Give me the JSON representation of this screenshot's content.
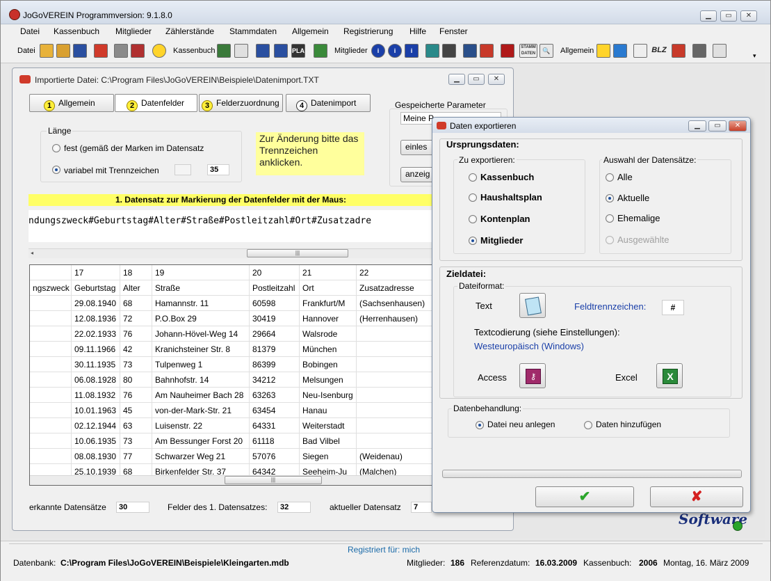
{
  "window": {
    "title": "JoGoVEREIN Programmversion: 9.1.8.0"
  },
  "menu": [
    "Datei",
    "Kassenbuch",
    "Mitglieder",
    "Zählerstände",
    "Stammdaten",
    "Allgemein",
    "Registrierung",
    "Hilfe",
    "Fenster"
  ],
  "toolbar": {
    "labels": {
      "datei": "Datei",
      "kassenbuch": "Kassenbuch",
      "mitglieder": "Mitglieder",
      "allgemein": "Allgemein"
    },
    "icon_texts": {
      "blz": "BLZ",
      "stamm": "STAMM DATEN",
      "plan": "PLAN"
    }
  },
  "import_window": {
    "title": "Importierte Datei: C:\\Program Files\\JoGoVEREIN\\Beispiele\\Datenimport.TXT",
    "tabs": [
      "Allgemein",
      "Datenfelder",
      "Felderzuordnung",
      "Datenimport"
    ],
    "tab_numbers": [
      "1",
      "2",
      "3",
      "4"
    ],
    "laenge": {
      "title": "Länge",
      "opt_fest": "fest (gemäß der Marken im Datensatz",
      "opt_variabel": "variabel mit Trennzeichen",
      "trenn_value": "",
      "field_count": "35"
    },
    "hint": "Zur Änderung bitte das Trennzeichen anklicken.",
    "params": {
      "title": "Gespeicherte Parameter",
      "value": "Meine P",
      "btn_einlesen": "einles",
      "btn_anzeigen": "anzeig"
    },
    "banner": "1. Datensatz zur Markierung der Datenfelder mit der Maus:",
    "record_line": "ndungszweck#Geburtstag#Alter#Straße#Postleitzahl#Ort#Zusatzadre",
    "grid": {
      "col_numbers": [
        "",
        "17",
        "18",
        "19",
        "20",
        "21",
        "22"
      ],
      "col_names": [
        "ngszweck",
        "Geburtstag",
        "Alter",
        "Straße",
        "Postleitzahl",
        "Ort",
        "Zusatzadresse"
      ],
      "rows": [
        [
          "",
          "29.08.1940",
          "68",
          "Hamannstr. 11",
          "60598",
          "Frankfurt/M",
          "(Sachsenhausen)"
        ],
        [
          "",
          "12.08.1936",
          "72",
          "P.O.Box 29",
          "30419",
          "Hannover",
          "(Herrenhausen)"
        ],
        [
          "",
          "22.02.1933",
          "76",
          "Johann-Hövel-Weg 14",
          "29664",
          "Walsrode",
          ""
        ],
        [
          "",
          "09.11.1966",
          "42",
          "Kranichsteiner Str. 8",
          "81379",
          "München",
          ""
        ],
        [
          "",
          "30.11.1935",
          "73",
          "Tulpenweg 1",
          "86399",
          "Bobingen",
          ""
        ],
        [
          "",
          "06.08.1928",
          "80",
          "Bahnhofstr. 14",
          "34212",
          "Melsungen",
          ""
        ],
        [
          "",
          "11.08.1932",
          "76",
          "Am Nauheimer Bach 28",
          "63263",
          "Neu-Isenburg",
          ""
        ],
        [
          "",
          "10.01.1963",
          "45",
          "von-der-Mark-Str. 21",
          "63454",
          "Hanau",
          ""
        ],
        [
          "",
          "02.12.1944",
          "63",
          "Luisenstr. 22",
          "64331",
          "Weiterstadt",
          ""
        ],
        [
          "",
          "10.06.1935",
          "73",
          "Am Bessunger Forst 20",
          "61118",
          "Bad Vilbel",
          ""
        ],
        [
          "",
          "08.08.1930",
          "77",
          "Schwarzer Weg 21",
          "57076",
          "Siegen",
          "(Weidenau)"
        ],
        [
          "",
          "25.10.1939",
          "68",
          "Birkenfelder Str. 37",
          "64342",
          "Seeheim-Ju",
          "(Malchen)"
        ]
      ]
    },
    "footer": {
      "erkannt_label": "erkannte Datensätze",
      "erkannt_value": "30",
      "felder_label": "Felder des 1. Datensatzes:",
      "felder_value": "32",
      "aktuell_label": "aktueller Datensatz",
      "aktuell_value": "7"
    }
  },
  "export_dialog": {
    "title": "Daten exportieren",
    "ursprung_title": "Ursprungsdaten:",
    "zu_exportieren_title": "Zu exportieren:",
    "zu_exportieren": [
      "Kassenbuch",
      "Haushaltsplan",
      "Kontenplan",
      "Mitglieder"
    ],
    "zu_exportieren_selected": 3,
    "auswahl_title": "Auswahl der Datensätze:",
    "auswahl": [
      "Alle",
      "Aktuelle",
      "Ehemalige",
      "Ausgewählte"
    ],
    "auswahl_selected": 1,
    "ziel_title": "Zieldatei:",
    "dateiformat_title": "Dateiformat:",
    "text_label": "Text",
    "feldtrenn_label": "Feldtrennzeichen:",
    "feldtrenn_value": "#",
    "textcodierung_label": "Textcodierung (siehe Einstellungen):",
    "textcodierung_value": "Westeuropäisch (Windows)",
    "access_label": "Access",
    "excel_label": "Excel",
    "behandlung_title": "Datenbehandlung:",
    "behandlung": [
      "Datei neu anlegen",
      "Daten hinzufügen"
    ],
    "behandlung_selected": 0,
    "ok_symbol": "✔",
    "cancel_symbol": "✘"
  },
  "logo_text": "Software",
  "statusbar": {
    "registered": "Registriert für: mich",
    "db_label": "Datenbank:",
    "db_value": "C:\\Program Files\\JoGoVEREIN\\Beispiele\\Kleingarten.mdb",
    "mitglieder_label": "Mitglieder:",
    "mitglieder_value": "186",
    "ref_label": "Referenzdatum:",
    "ref_value": "16.03.2009",
    "kassenbuch_label": "Kassenbuch:",
    "kassenbuch_value": "2006",
    "date_text": "Montag, 16. März 2009"
  },
  "colors": {
    "hint_bg": "#ffff9c",
    "banner_bg": "#ffff66",
    "link_blue": "#1a3fa8",
    "ok_green": "#2aa52a",
    "cancel_red": "#d42020"
  }
}
